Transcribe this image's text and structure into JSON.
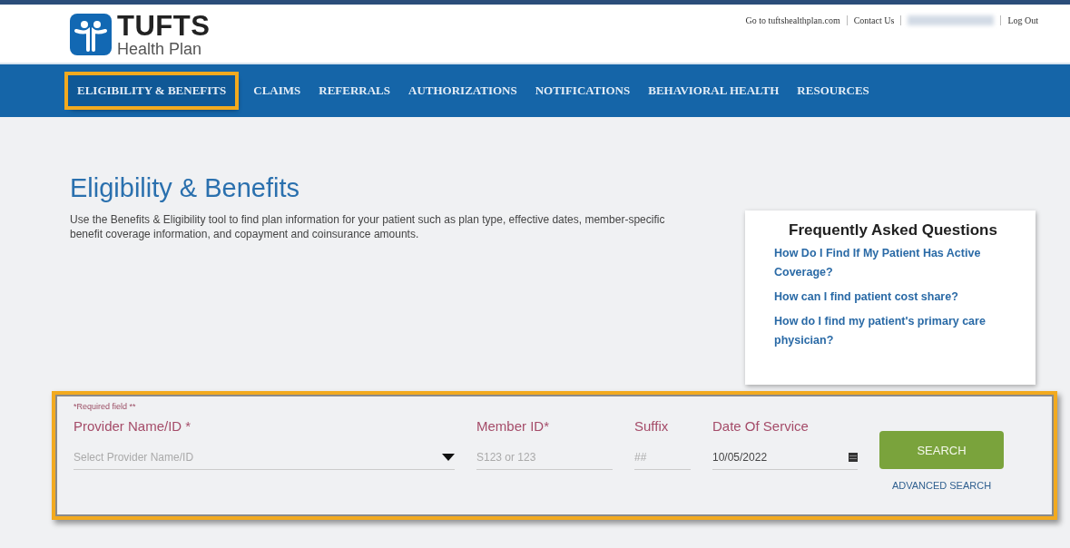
{
  "header": {
    "logo": {
      "name": "TUFTS",
      "subtitle": "Health Plan"
    },
    "links": [
      {
        "label": "Go to tuftshealthplan.com",
        "kind": "link"
      },
      {
        "label": "Contact Us",
        "kind": "link"
      },
      {
        "kind": "blurred"
      },
      {
        "label": "Log Out",
        "kind": "link"
      }
    ]
  },
  "nav": [
    {
      "label": "ELIGIBILITY & BENEFITS",
      "highlighted": true
    },
    {
      "label": "CLAIMS",
      "highlighted": false
    },
    {
      "label": "REFERRALS",
      "highlighted": false
    },
    {
      "label": "AUTHORIZATIONS",
      "highlighted": false
    },
    {
      "label": "NOTIFICATIONS",
      "highlighted": false
    },
    {
      "label": "BEHAVIORAL HEALTH",
      "highlighted": false
    },
    {
      "label": "RESOURCES",
      "highlighted": false
    }
  ],
  "page": {
    "title": "Eligibility & Benefits",
    "description": "Use the Benefits & Eligibility tool to find plan information for your patient such as plan type, effective dates, member-specific benefit coverage information, and copayment and coinsurance amounts."
  },
  "faq": {
    "title": "Frequently Asked Questions",
    "links": [
      "How Do I Find If My Patient Has Active Coverage?",
      "How can I find patient cost share?",
      "How do I find my patient's primary care physician?"
    ]
  },
  "search_form": {
    "highlighted": true,
    "required_note": "*Required field **",
    "fields": [
      {
        "label": "Provider Name/ID *",
        "placeholder": "Select Provider Name/ID",
        "kind": "dropdown"
      },
      {
        "label": "Member ID*",
        "placeholder": "S123 or 123",
        "kind": "text"
      },
      {
        "label": "Suffix",
        "placeholder": "##",
        "kind": "text"
      },
      {
        "label": "Date Of Service",
        "value": "10/05/2022",
        "kind": "date"
      }
    ],
    "search_button": "SEARCH",
    "advanced_link": "ADVANCED SEARCH"
  }
}
